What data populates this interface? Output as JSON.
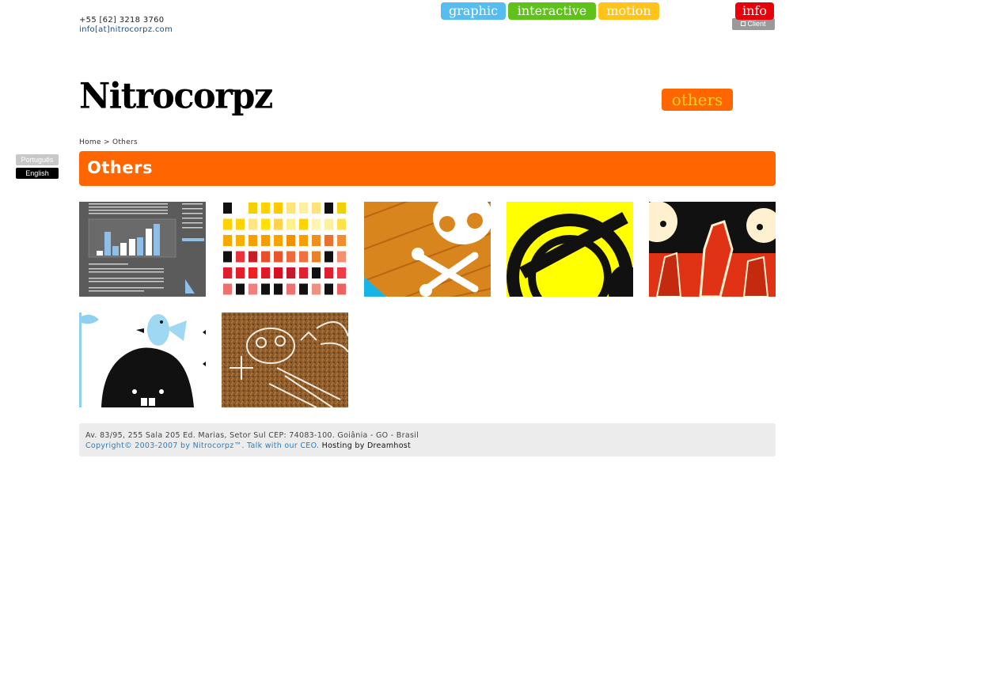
{
  "header": {
    "phone": "+55 [62] 3218 3760",
    "email": "info[at]nitrocorpz.com",
    "client_label": "Client",
    "logo": "Nitrocorpz"
  },
  "nav": [
    {
      "label": "graphic",
      "color": "#56bdf0"
    },
    {
      "label": "interactive",
      "color": "#5fc21a"
    },
    {
      "label": "motion",
      "color": "#ffc31a"
    },
    {
      "label": "others",
      "color": "#ff6600"
    },
    {
      "label": "info",
      "color": "#e8000a"
    }
  ],
  "languages": [
    {
      "label": "Português",
      "color": "#c8c8c8"
    },
    {
      "label": "English",
      "color": "#000000"
    }
  ],
  "breadcrumb": "Home > Others",
  "page_title": "Others",
  "thumbnails": [
    {
      "name": "thumb-infographic-chart"
    },
    {
      "name": "thumb-color-swatches"
    },
    {
      "name": "thumb-skull-crossbones-wood"
    },
    {
      "name": "thumb-yellow-letter-e"
    },
    {
      "name": "thumb-red-fists"
    },
    {
      "name": "thumb-furry-monster-bird"
    },
    {
      "name": "thumb-skeleton-cat-sketch"
    }
  ],
  "footer": {
    "address": "Av. 83/95, 255 Sala 205 Ed. Marias, Setor Sul CEP: 74083-100. Goiânia - GO - Brasil",
    "copyright": "Copyright© 2003-2007 by Nitrocorpz™.",
    "ceo_link": "Talk with our CEO.",
    "hosting": "Hosting by Dreamhost"
  }
}
